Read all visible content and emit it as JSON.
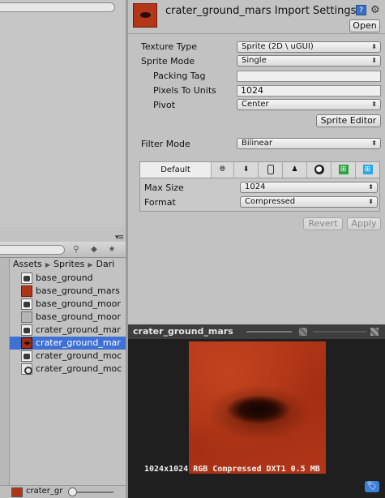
{
  "project": {
    "breadcrumb": [
      "Assets",
      "Sprites",
      "Dari"
    ],
    "items": [
      {
        "label": "base_ground",
        "thumb": "file-icon",
        "expandable": false,
        "selected": false
      },
      {
        "label": "base_ground_mars",
        "thumb": "red-texture",
        "expandable": true,
        "selected": false
      },
      {
        "label": "base_ground_moor",
        "thumb": "file-icon",
        "expandable": false,
        "selected": false
      },
      {
        "label": "base_ground_moor",
        "thumb": "moon-texture",
        "expandable": true,
        "selected": false
      },
      {
        "label": "crater_ground_mar",
        "thumb": "file-icon",
        "expandable": false,
        "selected": false
      },
      {
        "label": "crater_ground_mar",
        "thumb": "crater-texture",
        "expandable": true,
        "selected": true
      },
      {
        "label": "crater_ground_moc",
        "thumb": "file-icon",
        "expandable": false,
        "selected": false
      },
      {
        "label": "crater_ground_moc",
        "thumb": "sprite-icon",
        "expandable": true,
        "selected": false
      }
    ],
    "footer_text": "crater_gr",
    "menu": "▾≡"
  },
  "inspector": {
    "title": "crater_ground_mars Import Settings",
    "help_icon": "?",
    "open_label": "Open",
    "texture_type": {
      "label": "Texture Type",
      "value": "Sprite (2D \\ uGUI)"
    },
    "sprite_mode": {
      "label": "Sprite Mode",
      "value": "Single"
    },
    "packing_tag": {
      "label": "Packing Tag",
      "value": ""
    },
    "pixels_to_units": {
      "label": "Pixels To Units",
      "value": "1024"
    },
    "pivot": {
      "label": "Pivot",
      "value": "Center"
    },
    "sprite_editor_label": "Sprite Editor",
    "filter_mode": {
      "label": "Filter Mode",
      "value": "Bilinear"
    },
    "platform_tabs": [
      "Default",
      "web-icon",
      "download-icon",
      "phone-icon",
      "android-icon",
      "blackberry-icon",
      "windows-store-icon",
      "windows-phone-icon"
    ],
    "max_size": {
      "label": "Max Size",
      "value": "1024"
    },
    "format": {
      "label": "Format",
      "value": "Compressed"
    },
    "revert_label": "Revert",
    "apply_label": "Apply"
  },
  "preview": {
    "title": "crater_ground_mars",
    "info": "1024x1024  RGB Compressed DXT1   0.5 MB"
  },
  "colors": {
    "selection": "#3f70d4",
    "texture": "#b03517",
    "panel": "#c2c2c2"
  }
}
